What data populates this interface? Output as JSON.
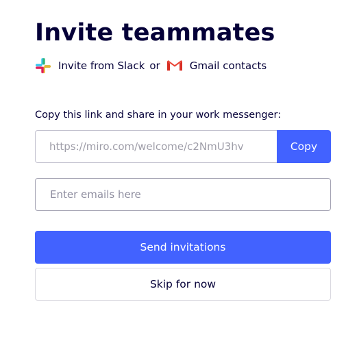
{
  "header": {
    "title": "Invite teammates"
  },
  "integrations": {
    "slack": {
      "label": "Invite from Slack",
      "icon": "slack-icon"
    },
    "separator": "or",
    "gmail": {
      "label": "Gmail contacts",
      "icon": "gmail-icon"
    }
  },
  "share_link": {
    "label": "Copy this link and share in your work messenger:",
    "value": "https://miro.com/welcome/c2NmU3hv",
    "copy_label": "Copy"
  },
  "emails": {
    "placeholder": "Enter emails here",
    "value": ""
  },
  "actions": {
    "send_label": "Send invitations",
    "skip_label": "Skip for now"
  },
  "colors": {
    "accent": "#4262ff",
    "text": "#050038",
    "border": "#c3c2cf"
  }
}
